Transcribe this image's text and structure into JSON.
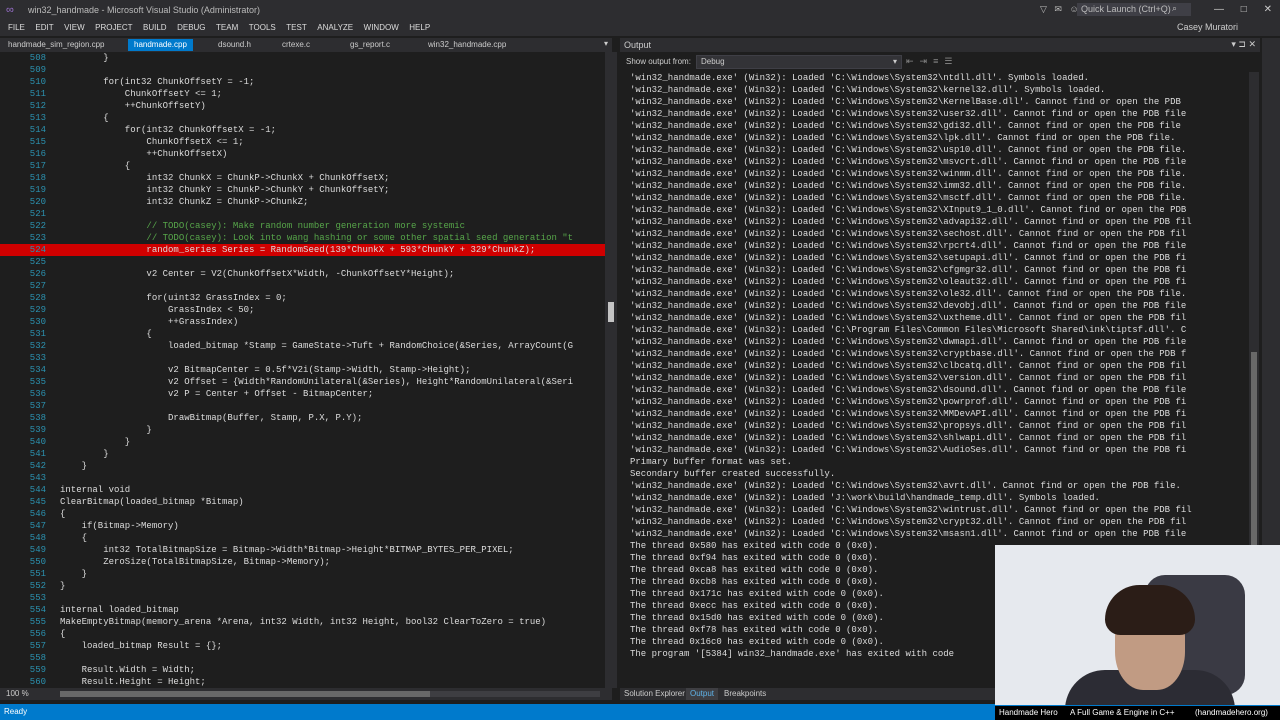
{
  "window": {
    "title": "win32_handmade - Microsoft Visual Studio (Administrator)",
    "quick_launch": "Quick Launch (Ctrl+Q)",
    "user": "Casey Muratori"
  },
  "menu": [
    "FILE",
    "EDIT",
    "VIEW",
    "PROJECT",
    "BUILD",
    "DEBUG",
    "TEAM",
    "TOOLS",
    "TEST",
    "ANALYZE",
    "WINDOW",
    "HELP"
  ],
  "tabs": [
    "handmade_sim_region.cpp",
    "handmade.cpp",
    "dsound.h",
    "crtexe.c",
    "gs_report.c",
    "win32_handmade.cpp"
  ],
  "editor": {
    "zoom": "100 %",
    "highlight_line": 524,
    "lines": [
      {
        "n": "508",
        "t": "        }"
      },
      {
        "n": "509",
        "t": ""
      },
      {
        "n": "510",
        "t": "        for(int32 ChunkOffsetY = -1;"
      },
      {
        "n": "511",
        "t": "            ChunkOffsetY <= 1;"
      },
      {
        "n": "512",
        "t": "            ++ChunkOffsetY)"
      },
      {
        "n": "513",
        "t": "        {"
      },
      {
        "n": "514",
        "t": "            for(int32 ChunkOffsetX = -1;"
      },
      {
        "n": "515",
        "t": "                ChunkOffsetX <= 1;"
      },
      {
        "n": "516",
        "t": "                ++ChunkOffsetX)"
      },
      {
        "n": "517",
        "t": "            {"
      },
      {
        "n": "518",
        "t": "                int32 ChunkX = ChunkP->ChunkX + ChunkOffsetX;"
      },
      {
        "n": "519",
        "t": "                int32 ChunkY = ChunkP->ChunkY + ChunkOffsetY;"
      },
      {
        "n": "520",
        "t": "                int32 ChunkZ = ChunkP->ChunkZ;"
      },
      {
        "n": "521",
        "t": ""
      },
      {
        "n": "522",
        "t": "                // TODO(casey): Make random number generation more systemic"
      },
      {
        "n": "523",
        "t": "                // TODO(casey): Look into wang hashing or some other spatial seed generation \"t"
      },
      {
        "n": "524",
        "t": "                random_series Series = RandomSeed(139*ChunkX + 593*ChunkY + 329*ChunkZ);"
      },
      {
        "n": "525",
        "t": ""
      },
      {
        "n": "526",
        "t": "                v2 Center = V2(ChunkOffsetX*Width, -ChunkOffsetY*Height);"
      },
      {
        "n": "527",
        "t": ""
      },
      {
        "n": "528",
        "t": "                for(uint32 GrassIndex = 0;"
      },
      {
        "n": "529",
        "t": "                    GrassIndex < 50;"
      },
      {
        "n": "530",
        "t": "                    ++GrassIndex)"
      },
      {
        "n": "531",
        "t": "                {"
      },
      {
        "n": "532",
        "t": "                    loaded_bitmap *Stamp = GameState->Tuft + RandomChoice(&Series, ArrayCount(G"
      },
      {
        "n": "533",
        "t": ""
      },
      {
        "n": "534",
        "t": "                    v2 BitmapCenter = 0.5f*V2i(Stamp->Width, Stamp->Height);"
      },
      {
        "n": "535",
        "t": "                    v2 Offset = {Width*RandomUnilateral(&Series), Height*RandomUnilateral(&Seri"
      },
      {
        "n": "536",
        "t": "                    v2 P = Center + Offset - BitmapCenter;"
      },
      {
        "n": "537",
        "t": ""
      },
      {
        "n": "538",
        "t": "                    DrawBitmap(Buffer, Stamp, P.X, P.Y);"
      },
      {
        "n": "539",
        "t": "                }"
      },
      {
        "n": "540",
        "t": "            }"
      },
      {
        "n": "541",
        "t": "        }"
      },
      {
        "n": "542",
        "t": "    }"
      },
      {
        "n": "543",
        "t": ""
      },
      {
        "n": "544",
        "t": "internal void"
      },
      {
        "n": "545",
        "t": "ClearBitmap(loaded_bitmap *Bitmap)"
      },
      {
        "n": "546",
        "t": "{"
      },
      {
        "n": "547",
        "t": "    if(Bitmap->Memory)"
      },
      {
        "n": "548",
        "t": "    {"
      },
      {
        "n": "549",
        "t": "        int32 TotalBitmapSize = Bitmap->Width*Bitmap->Height*BITMAP_BYTES_PER_PIXEL;"
      },
      {
        "n": "550",
        "t": "        ZeroSize(TotalBitmapSize, Bitmap->Memory);"
      },
      {
        "n": "551",
        "t": "    }"
      },
      {
        "n": "552",
        "t": "}"
      },
      {
        "n": "553",
        "t": ""
      },
      {
        "n": "554",
        "t": "internal loaded_bitmap"
      },
      {
        "n": "555",
        "t": "MakeEmptyBitmap(memory_arena *Arena, int32 Width, int32 Height, bool32 ClearToZero = true)"
      },
      {
        "n": "556",
        "t": "{"
      },
      {
        "n": "557",
        "t": "    loaded_bitmap Result = {};"
      },
      {
        "n": "558",
        "t": ""
      },
      {
        "n": "559",
        "t": "    Result.Width = Width;"
      },
      {
        "n": "560",
        "t": "    Result.Height = Height;"
      }
    ]
  },
  "output": {
    "title": "Output",
    "show_output_from": "Show output from:",
    "source": "Debug",
    "lines": [
      "'win32_handmade.exe' (Win32): Loaded 'C:\\Windows\\System32\\ntdll.dll'. Symbols loaded.",
      "'win32_handmade.exe' (Win32): Loaded 'C:\\Windows\\System32\\kernel32.dll'. Symbols loaded.",
      "'win32_handmade.exe' (Win32): Loaded 'C:\\Windows\\System32\\KernelBase.dll'. Cannot find or open the PDB",
      "'win32_handmade.exe' (Win32): Loaded 'C:\\Windows\\System32\\user32.dll'. Cannot find or open the PDB file",
      "'win32_handmade.exe' (Win32): Loaded 'C:\\Windows\\System32\\gdi32.dll'. Cannot find or open the PDB file",
      "'win32_handmade.exe' (Win32): Loaded 'C:\\Windows\\System32\\lpk.dll'. Cannot find or open the PDB file.",
      "'win32_handmade.exe' (Win32): Loaded 'C:\\Windows\\System32\\usp10.dll'. Cannot find or open the PDB file.",
      "'win32_handmade.exe' (Win32): Loaded 'C:\\Windows\\System32\\msvcrt.dll'. Cannot find or open the PDB file",
      "'win32_handmade.exe' (Win32): Loaded 'C:\\Windows\\System32\\winmm.dll'. Cannot find or open the PDB file.",
      "'win32_handmade.exe' (Win32): Loaded 'C:\\Windows\\System32\\imm32.dll'. Cannot find or open the PDB file.",
      "'win32_handmade.exe' (Win32): Loaded 'C:\\Windows\\System32\\msctf.dll'. Cannot find or open the PDB file.",
      "'win32_handmade.exe' (Win32): Loaded 'C:\\Windows\\System32\\XInput9_1_0.dll'. Cannot find or open the PDB",
      "'win32_handmade.exe' (Win32): Loaded 'C:\\Windows\\System32\\advapi32.dll'. Cannot find or open the PDB fil",
      "'win32_handmade.exe' (Win32): Loaded 'C:\\Windows\\System32\\sechost.dll'. Cannot find or open the PDB fil",
      "'win32_handmade.exe' (Win32): Loaded 'C:\\Windows\\System32\\rpcrt4.dll'. Cannot find or open the PDB file",
      "'win32_handmade.exe' (Win32): Loaded 'C:\\Windows\\System32\\setupapi.dll'. Cannot find or open the PDB fi",
      "'win32_handmade.exe' (Win32): Loaded 'C:\\Windows\\System32\\cfgmgr32.dll'. Cannot find or open the PDB fi",
      "'win32_handmade.exe' (Win32): Loaded 'C:\\Windows\\System32\\oleaut32.dll'. Cannot find or open the PDB fi",
      "'win32_handmade.exe' (Win32): Loaded 'C:\\Windows\\System32\\ole32.dll'. Cannot find or open the PDB file.",
      "'win32_handmade.exe' (Win32): Loaded 'C:\\Windows\\System32\\devobj.dll'. Cannot find or open the PDB file",
      "'win32_handmade.exe' (Win32): Loaded 'C:\\Windows\\System32\\uxtheme.dll'. Cannot find or open the PDB fil",
      "'win32_handmade.exe' (Win32): Loaded 'C:\\Program Files\\Common Files\\Microsoft Shared\\ink\\tiptsf.dll'. C",
      "'win32_handmade.exe' (Win32): Loaded 'C:\\Windows\\System32\\dwmapi.dll'. Cannot find or open the PDB file",
      "'win32_handmade.exe' (Win32): Loaded 'C:\\Windows\\System32\\cryptbase.dll'. Cannot find or open the PDB f",
      "'win32_handmade.exe' (Win32): Loaded 'C:\\Windows\\System32\\clbcatq.dll'. Cannot find or open the PDB fil",
      "'win32_handmade.exe' (Win32): Loaded 'C:\\Windows\\System32\\version.dll'. Cannot find or open the PDB fil",
      "'win32_handmade.exe' (Win32): Loaded 'C:\\Windows\\System32\\dsound.dll'. Cannot find or open the PDB file",
      "'win32_handmade.exe' (Win32): Loaded 'C:\\Windows\\System32\\powrprof.dll'. Cannot find or open the PDB fi",
      "'win32_handmade.exe' (Win32): Loaded 'C:\\Windows\\System32\\MMDevAPI.dll'. Cannot find or open the PDB fi",
      "'win32_handmade.exe' (Win32): Loaded 'C:\\Windows\\System32\\propsys.dll'. Cannot find or open the PDB fil",
      "'win32_handmade.exe' (Win32): Loaded 'C:\\Windows\\System32\\shlwapi.dll'. Cannot find or open the PDB fil",
      "'win32_handmade.exe' (Win32): Loaded 'C:\\Windows\\System32\\AudioSes.dll'. Cannot find or open the PDB fi",
      "Primary buffer format was set.",
      "Secondary buffer created successfully.",
      "'win32_handmade.exe' (Win32): Loaded 'C:\\Windows\\System32\\avrt.dll'. Cannot find or open the PDB file.",
      "'win32_handmade.exe' (Win32): Loaded 'J:\\work\\build\\handmade_temp.dll'. Symbols loaded.",
      "'win32_handmade.exe' (Win32): Loaded 'C:\\Windows\\System32\\wintrust.dll'. Cannot find or open the PDB fil",
      "'win32_handmade.exe' (Win32): Loaded 'C:\\Windows\\System32\\crypt32.dll'. Cannot find or open the PDB fil",
      "'win32_handmade.exe' (Win32): Loaded 'C:\\Windows\\System32\\msasn1.dll'. Cannot find or open the PDB file",
      "The thread 0x580 has exited with code 0 (0x0).",
      "The thread 0xf94 has exited with code 0 (0x0).",
      "The thread 0xca8 has exited with code 0 (0x0).",
      "The thread 0xcb8 has exited with code 0 (0x0).",
      "The thread 0x171c has exited with code 0 (0x0).",
      "The thread 0xecc has exited with code 0 (0x0).",
      "The thread 0x15d0 has exited with code 0 (0x0).",
      "The thread 0xf78 has exited with code 0 (0x0).",
      "The thread 0x16c0 has exited with code 0 (0x0).",
      "The program '[5384] win32_handmade.exe' has exited with code"
    ]
  },
  "bottom_tabs": [
    "Solution Explorer",
    "Output",
    "Breakpoints"
  ],
  "status": {
    "ready": "Ready"
  },
  "stream_caption": {
    "left": "Handmade Hero",
    "middle": "A Full Game & Engine in C++",
    "right": "(handmadehero.org)"
  },
  "colors": {
    "accent": "#007acc",
    "highlight": "#d00000"
  }
}
